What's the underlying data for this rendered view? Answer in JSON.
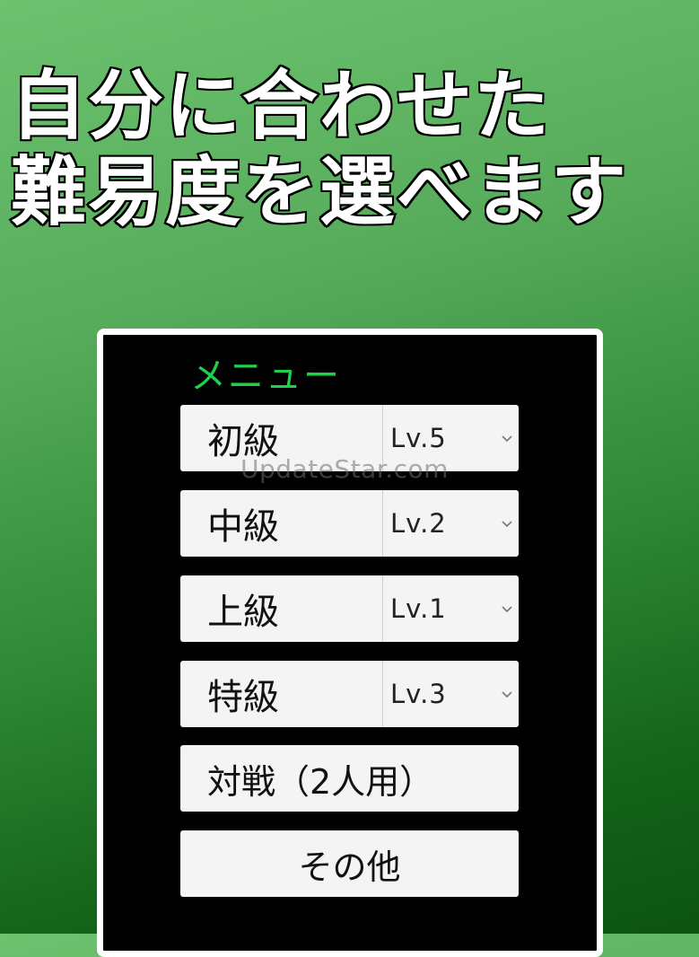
{
  "headline": {
    "line1": "自分に合わせた",
    "line2": "難易度を選べます"
  },
  "menu": {
    "title": "メニュー",
    "difficulty_rows": [
      {
        "label": "初級",
        "level": "Lv.5"
      },
      {
        "label": "中級",
        "level": "Lv.2"
      },
      {
        "label": "上級",
        "level": "Lv.1"
      },
      {
        "label": "特級",
        "level": "Lv.3"
      }
    ],
    "versus_label": "対戦（2人用）",
    "other_label": "その他"
  },
  "watermark": "UpdateStar.com",
  "colors": {
    "menu_title": "#1fd04a",
    "panel_background": "#000000",
    "panel_border": "#ffffff",
    "button_background": "#f4f4f4"
  }
}
